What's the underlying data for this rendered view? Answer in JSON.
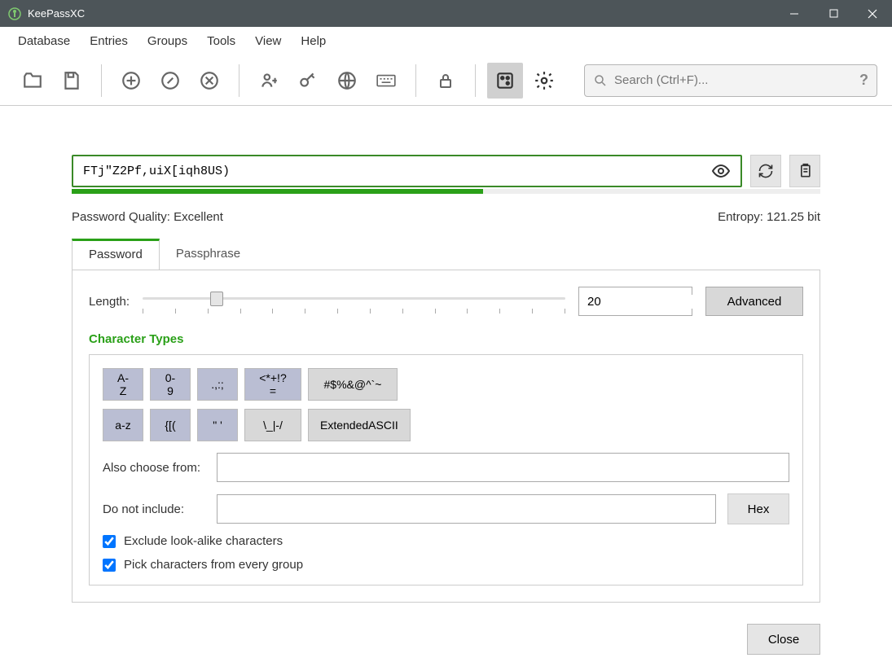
{
  "title": "KeePassXC",
  "menu": [
    "Database",
    "Entries",
    "Groups",
    "Tools",
    "View",
    "Help"
  ],
  "search": {
    "placeholder": "Search (Ctrl+F)..."
  },
  "password": "FTj\"Z2Pf,uiX[iqh8US)",
  "strength_pct": 55,
  "quality": {
    "label": "Password Quality:",
    "value": "Excellent"
  },
  "entropy": {
    "label": "Entropy:",
    "value": "121.25 bit"
  },
  "tabs": {
    "password": "Password",
    "passphrase": "Passphrase"
  },
  "length": {
    "label": "Length:",
    "value": "20",
    "thumb_pct": 16
  },
  "advanced": "Advanced",
  "char_types_label": "Character Types",
  "char_buttons": {
    "upper": "A-Z",
    "digits": "0-9",
    "punct": ".,:;",
    "math": "<*+!?=",
    "special": "#$%&@^`~",
    "lower": "a-z",
    "braces": "{[(",
    "quotes": "\" '",
    "slashes": "\\_|-/",
    "extascii": "ExtendedASCII"
  },
  "also_choose": "Also choose from:",
  "do_not_include": "Do not include:",
  "hex": "Hex",
  "checks": {
    "exclude": "Exclude look-alike characters",
    "pick": "Pick characters from every group"
  },
  "close": "Close"
}
